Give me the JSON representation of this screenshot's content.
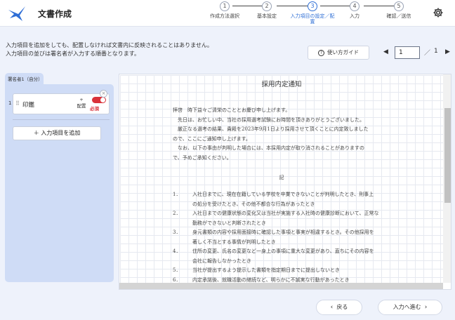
{
  "header": {
    "app_title": "文書作成",
    "steps": [
      {
        "num": "1",
        "label": "作成方法選択"
      },
      {
        "num": "2",
        "label": "基本設定"
      },
      {
        "num": "3",
        "label": "入力項目の設定／配置"
      },
      {
        "num": "4",
        "label": "入力"
      },
      {
        "num": "5",
        "label": "確認／送信"
      }
    ],
    "active_step": "3",
    "icons": {
      "logo": "bird-logo",
      "settings": "gear-icon"
    }
  },
  "toolbar": {
    "info_line1": "入力項目を追加をしても、配置しなければ文書内に反映されることはありません。",
    "info_line2": "入力項目の並びは署名者が入力する順番となります。",
    "guide_button": "使い方ガイド",
    "page_current": "1",
    "page_separator": "／",
    "page_total": "1"
  },
  "left_panel": {
    "signer_tab": "署名者1（自分）",
    "items": [
      {
        "num": "1",
        "label": "印鑑",
        "place_icon": "+",
        "place_label": "配置",
        "required_label": "必須",
        "required": true
      }
    ],
    "add_button": "＋ 入力項目を追加"
  },
  "document": {
    "title": "採用内定通知",
    "para1_l1": "拝啓　時下益々ご清栄のこととお慶び申し上げます。",
    "para1_l2": "　先日は、お忙しい中、当社の採用選考試験にお時間を頂きありがとうございました。",
    "para2_l1": "　厳正なる選考の結果、貴殿を2023年9月1日より採用させて頂くことに内定致しました",
    "para2_l2": "ので、ここにご通知申し上げます。",
    "para3_l1": "　なお、以下の事由が判明した場合には、本採用内定が取り消されることがありますの",
    "para3_l2": "で、予めご承知ください。",
    "ki": "記",
    "list": [
      {
        "n": "1．",
        "l1": "入社日までに、現在在籍している学校を卒業できないことが判明したとき、刑事上",
        "l2": "の処分を受けたとき、その他不都合な行為があったとき"
      },
      {
        "n": "2．",
        "l1": "入社日までの健康状態の変化又は当社が実施する入社時の健康診断において、正常な",
        "l2": "勤務ができないと判断されたとき"
      },
      {
        "n": "3．",
        "l1": "身元書類の内容や採用面接時に確認した事項と事実が相違するとき。その他採用を",
        "l2": "著しく不当とする事情が判明したとき"
      },
      {
        "n": "4．",
        "l1": "住所の変更、氏名の変更など一身上の事項に重大な変更があり、直ちにその内容を",
        "l2": "会社に報告しなかったとき"
      },
      {
        "n": "5．",
        "l1": "当社が提出するよう提示した書類を指定期日までに提出しないとき",
        "l2": ""
      },
      {
        "n": "6．",
        "l1": "内定承諾後、就職活動の継続など、明らかに不誠実な行動があったとき",
        "l2": ""
      }
    ]
  },
  "footer": {
    "back_button": "戻る",
    "next_button": "入力へ進む"
  }
}
